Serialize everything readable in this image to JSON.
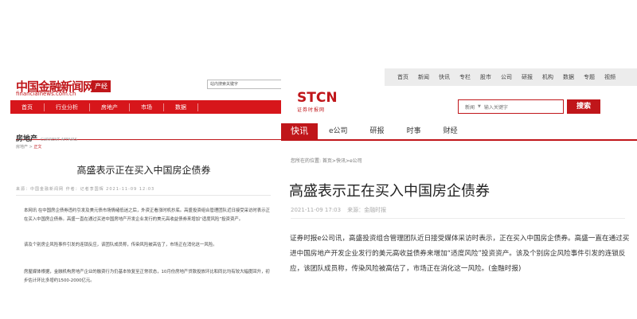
{
  "left": {
    "logo_cn": "中国金融新闻网",
    "logo_en": "financialnews.com.cn",
    "logo_tag": "产经",
    "search_placeholder": "站内搜索关键字",
    "nav": [
      "首页",
      "行业分析",
      "房地产",
      "市场",
      "数据"
    ],
    "section_cn": "房地产",
    "section_en": "CURRENT AFFAIRS",
    "crumb_prefix": "房地产 > ",
    "crumb_current": "正文",
    "title": "高盛表示正在买入中国房企债券",
    "meta": "来源：中国金融新闻网      作者：记者李国辉      2021-11-09 12:03",
    "paragraphs": [
      "本网讯 在中国房企债券违约引发及美元债市场情绪低迷之后，外资正看涨时机抄底。高盛投资组合管理团队近日接受采访时表示正在买入中国房企债券。高盛一直在通过买进中国房地产开发企业发行的美元高收益债券来增加“适度风险”投资资产。",
      "该及个别房企风险事件引发的连锁反应，该团队成员称，传染风险被高估了，市场正在消化这一风险。",
      "房屋媒体根据，金融机构房地产企业的融资行为仍基本恢复至正常状态，10月份房地产贷款投放环比和同比均有较大幅度回升，初步估计环比多增约1500-2000亿元。"
    ]
  },
  "right": {
    "topbar": [
      "首页",
      "新闻",
      "快讯",
      "专栏",
      "股市",
      "公司",
      "研报",
      "机构",
      "数据",
      "专题",
      "视频"
    ],
    "logo": "STCN",
    "logo_sub": "证券时报网",
    "search_category": "新闻",
    "search_caret": "▼",
    "search_placeholder": "输入关键字",
    "search_button": "搜索",
    "nav_active": "快讯",
    "nav": [
      "e公司",
      "研报",
      "时事",
      "财经"
    ],
    "crumb": "您所在的位置: 首页>快讯>e公司",
    "title": "高盛表示正在买入中国房企债券",
    "date": "2021-11-09 17:03",
    "source": "来源：金融时报",
    "body": "证券时报e公司讯，高盛投资组合管理团队近日接受媒体采访时表示，正在买入中国房企债券。高盛一直在通过买进中国房地产开发企业发行的美元高收益债券来增加“适度风险”投资资产。该及个别房企风险事件引发的连锁反应，该团队成员称，传染风险被高估了，市场正在消化这一风险。(金融时报)"
  }
}
